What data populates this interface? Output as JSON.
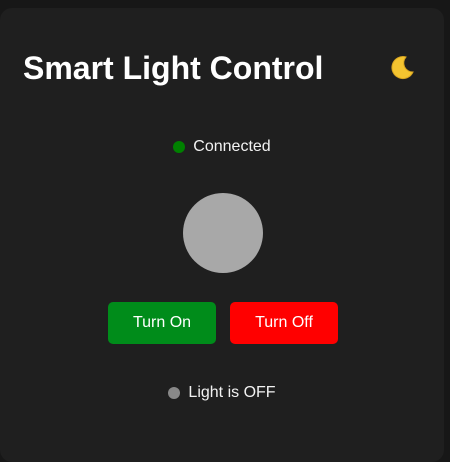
{
  "app": {
    "title": "Smart Light Control"
  },
  "theme_toggle": {
    "icon": "moon-icon",
    "glyph": "🌙"
  },
  "connection": {
    "label": "Connected",
    "color": "#008000"
  },
  "bulb": {
    "state": "off",
    "color": "#a8a8a8"
  },
  "controls": {
    "on_label": "Turn On",
    "on_color": "#008c1a",
    "off_label": "Turn Off",
    "off_color": "#ff0000"
  },
  "light_status": {
    "label": "Light is OFF",
    "color": "#888888"
  }
}
